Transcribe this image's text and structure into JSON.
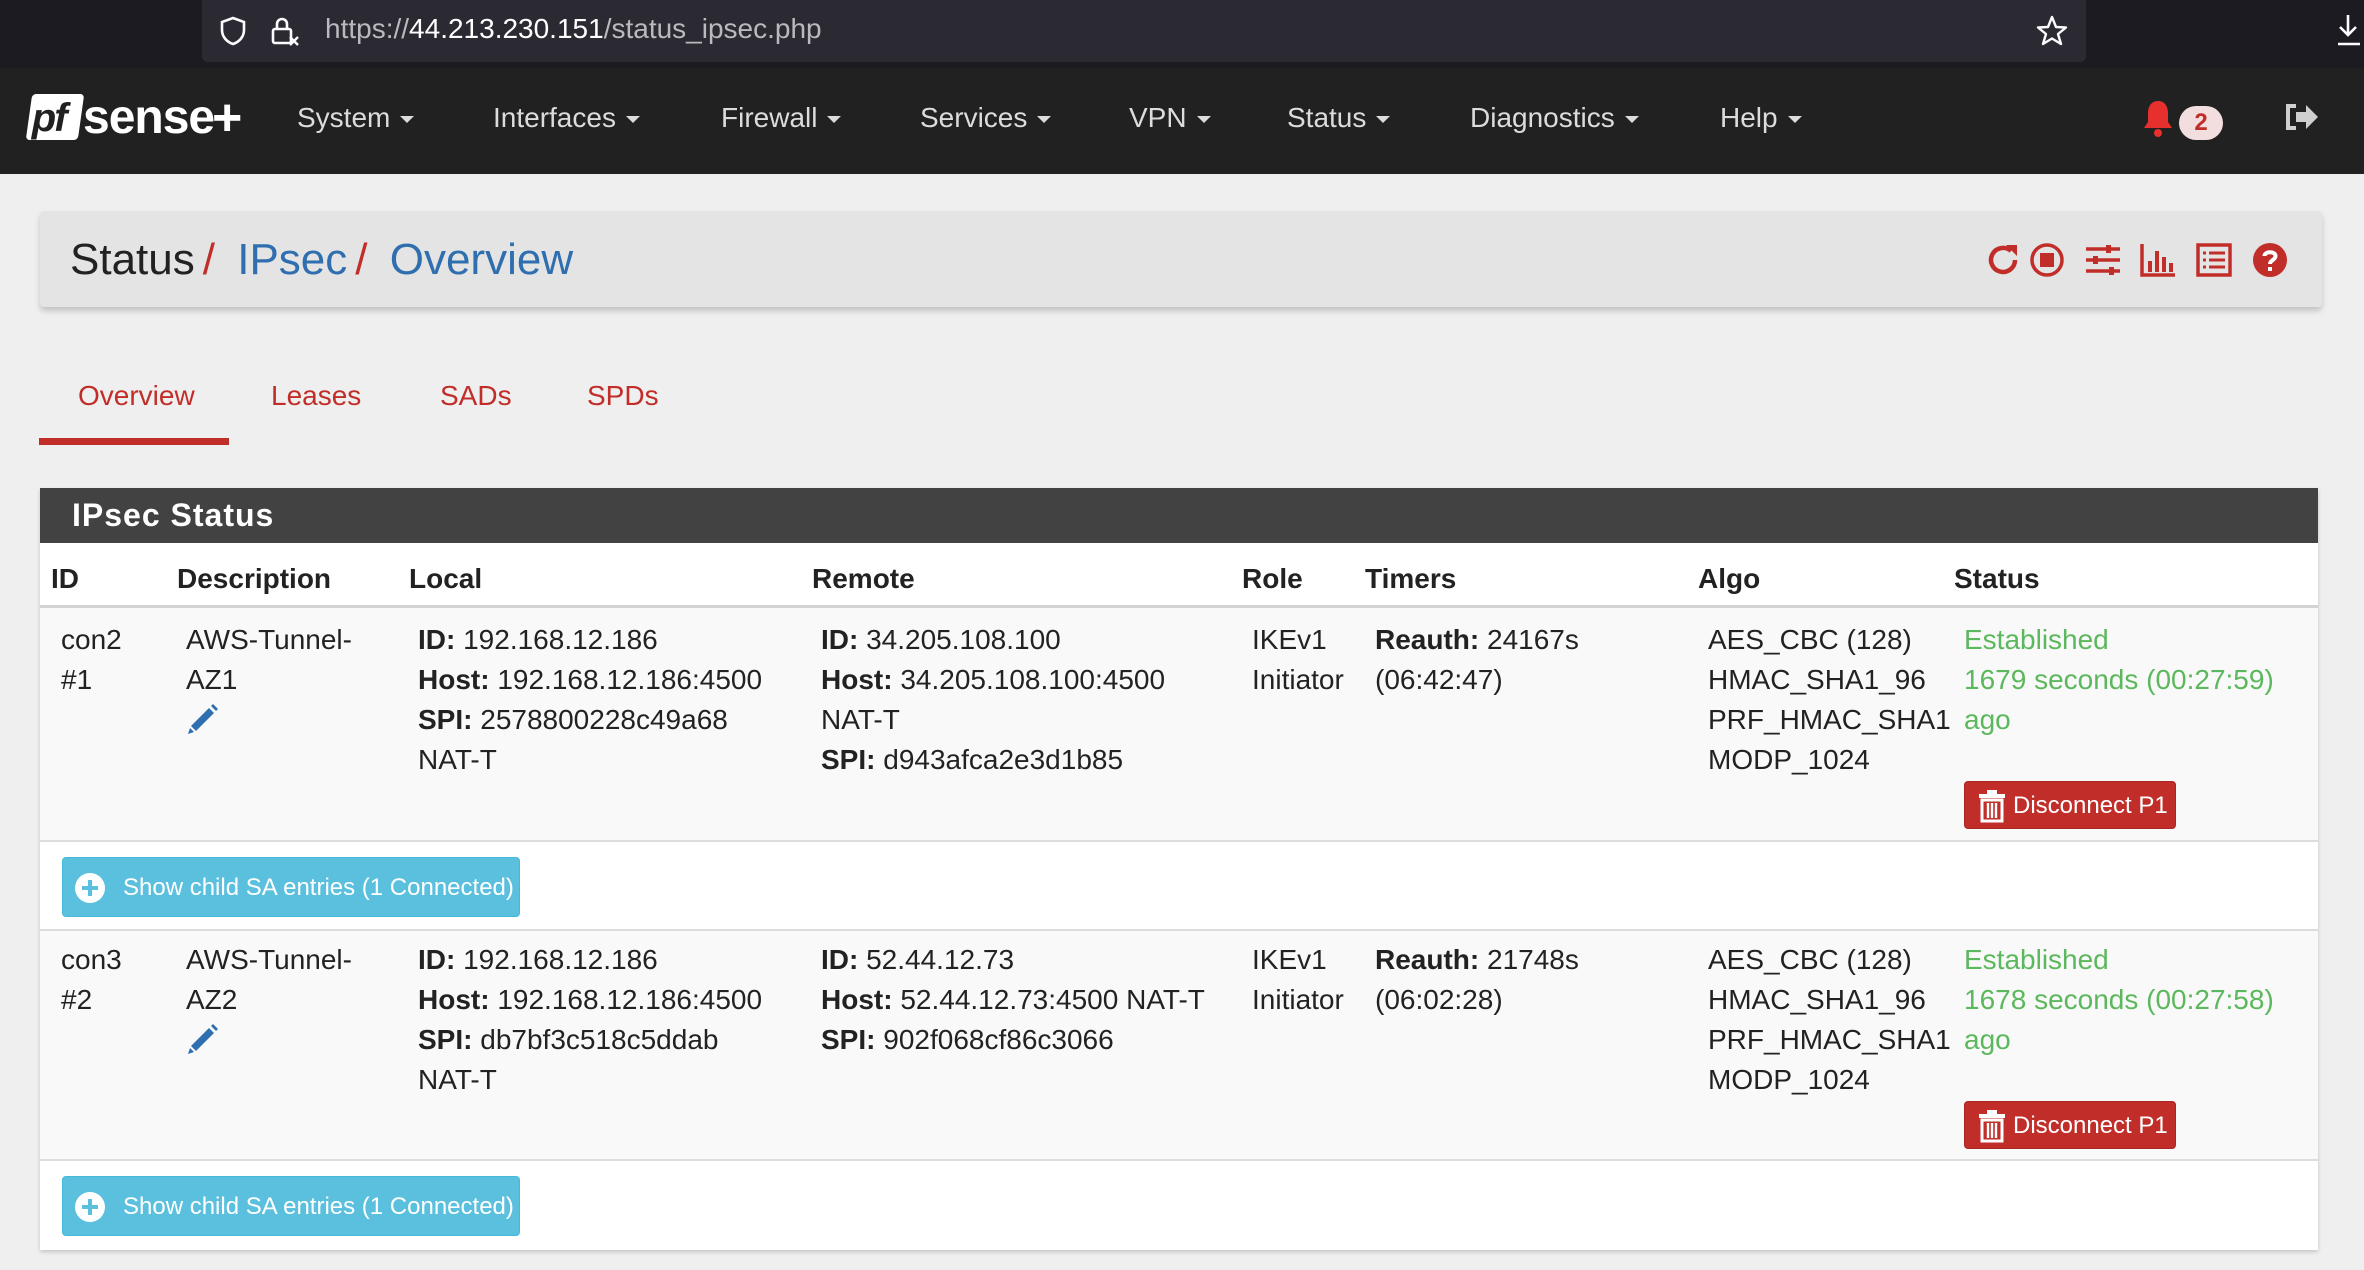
{
  "browser": {
    "url_prefix": "https://",
    "url_host": "44.213.230.151",
    "url_path": "/status_ipsec.php"
  },
  "nav": {
    "logo_pf": "pf",
    "logo_sense": "sense",
    "logo_plus": "+",
    "items": [
      "System",
      "Interfaces",
      "Firewall",
      "Services",
      "VPN",
      "Status",
      "Diagnostics",
      "Help"
    ],
    "notification_count": "2"
  },
  "breadcrumb": {
    "part1": "Status",
    "part2": "IPsec",
    "part3": "Overview",
    "separator": "/"
  },
  "tabs": [
    "Overview",
    "Leases",
    "SADs",
    "SPDs"
  ],
  "panel": {
    "title": "IPsec Status",
    "columns": [
      "ID",
      "Description",
      "Local",
      "Remote",
      "Role",
      "Timers",
      "Algo",
      "Status"
    ]
  },
  "rows": [
    {
      "id_line1": "con2",
      "id_line2": "#1",
      "desc_line1": "AWS-Tunnel-",
      "desc_line2": "AZ1",
      "local_id_label": "ID:",
      "local_id": "192.168.12.186",
      "local_host_label": "Host:",
      "local_host": "192.168.12.186:4500",
      "local_spi_label": "SPI:",
      "local_spi": "2578800228c49a68",
      "local_natt": "NAT-T",
      "remote_id_label": "ID:",
      "remote_id": "34.205.108.100",
      "remote_host_label": "Host:",
      "remote_host": "34.205.108.100:4500",
      "remote_natt": "NAT-T",
      "remote_spi_label": "SPI:",
      "remote_spi": "d943afca2e3d1b85",
      "role_line1": "IKEv1",
      "role_line2": "Initiator",
      "timer_label": "Reauth:",
      "timer_value": "24167s",
      "timer_line2": "(06:42:47)",
      "algo": [
        "AES_CBC (128)",
        "HMAC_SHA1_96",
        "PRF_HMAC_SHA1",
        "MODP_1024"
      ],
      "status_line1": "Established",
      "status_line2": "1679 seconds (00:27:59)",
      "status_line3": "ago",
      "disconnect_label": "Disconnect P1",
      "child_button_label": "Show child SA entries (1 Connected)"
    },
    {
      "id_line1": "con3",
      "id_line2": "#2",
      "desc_line1": "AWS-Tunnel-",
      "desc_line2": "AZ2",
      "local_id_label": "ID:",
      "local_id": "192.168.12.186",
      "local_host_label": "Host:",
      "local_host": "192.168.12.186:4500",
      "local_spi_label": "SPI:",
      "local_spi": "db7bf3c518c5ddab",
      "local_natt": "NAT-T",
      "remote_id_label": "ID:",
      "remote_id": "52.44.12.73",
      "remote_host_label": "Host:",
      "remote_host": "52.44.12.73:4500 NAT-T",
      "remote_spi_label": "SPI:",
      "remote_spi": "902f068cf86c3066",
      "role_line1": "IKEv1",
      "role_line2": "Initiator",
      "timer_label": "Reauth:",
      "timer_value": "21748s",
      "timer_line2": "(06:02:28)",
      "algo": [
        "AES_CBC (128)",
        "HMAC_SHA1_96",
        "PRF_HMAC_SHA1",
        "MODP_1024"
      ],
      "status_line1": "Established",
      "status_line2": "1678 seconds (00:27:58)",
      "status_line3": "ago",
      "disconnect_label": "Disconnect P1",
      "child_button_label": "Show child SA entries (1 Connected)"
    }
  ],
  "colors": {
    "accent_red": "#c12e2a",
    "link_blue": "#2f6fb0",
    "status_green": "#5cb85c",
    "info_blue": "#5bc0de",
    "navbar": "#212121",
    "panel_head": "#424242"
  },
  "icons": [
    "shield-icon",
    "lock-icon",
    "star-icon",
    "download-icon",
    "bell-icon",
    "logout-icon",
    "reload-icon",
    "stop-icon",
    "settings-icon",
    "chart-icon",
    "log-icon",
    "help-icon",
    "pencil-icon",
    "trash-icon",
    "plus-circle-icon"
  ]
}
